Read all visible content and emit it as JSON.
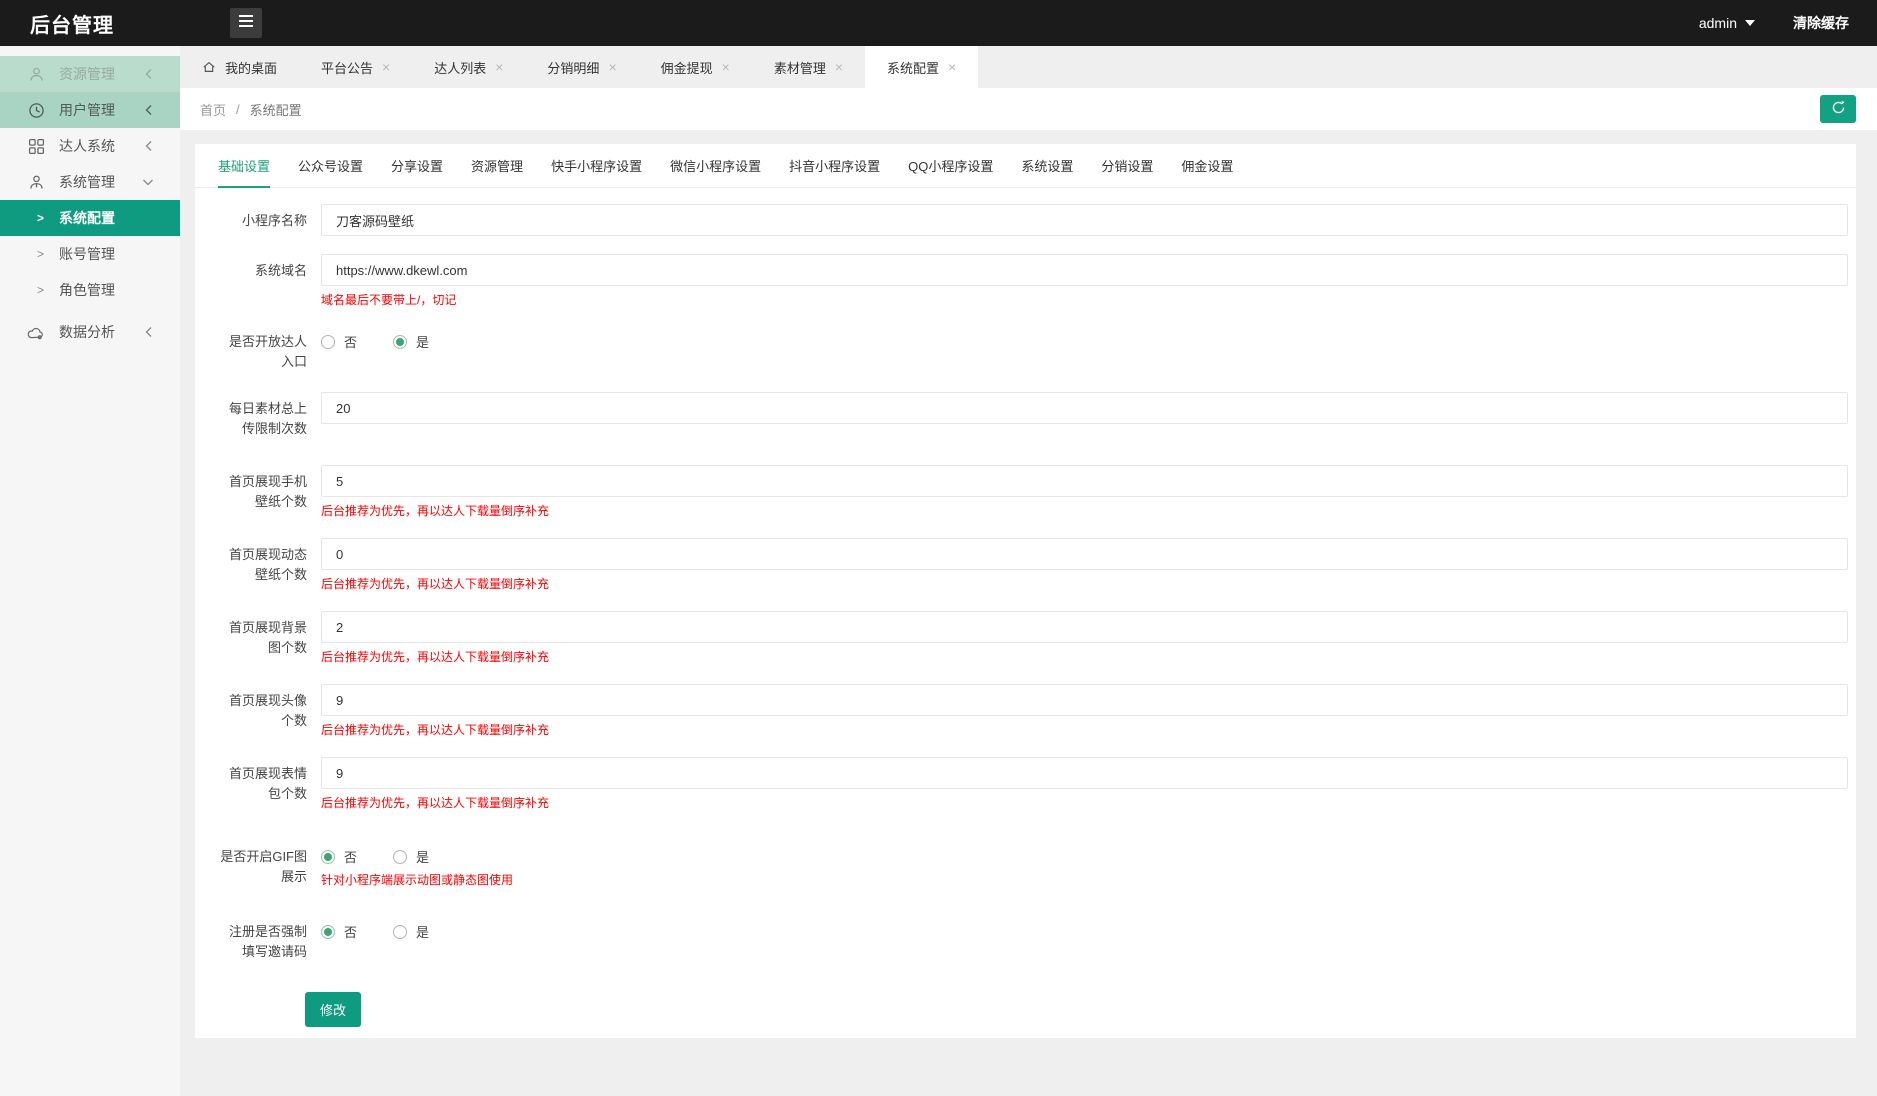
{
  "header": {
    "title": "后台管理",
    "user": "admin",
    "clear_cache_label": "清除缓存"
  },
  "window_tabs": {
    "items": [
      {
        "label": "我的桌面",
        "closable": false,
        "active": false
      },
      {
        "label": "平台公告",
        "closable": true,
        "active": false
      },
      {
        "label": "达人列表",
        "closable": true,
        "active": false
      },
      {
        "label": "分销明细",
        "closable": true,
        "active": false
      },
      {
        "label": "佣金提现",
        "closable": true,
        "active": false
      },
      {
        "label": "素材管理",
        "closable": true,
        "active": false
      },
      {
        "label": "系统配置",
        "closable": true,
        "active": true
      }
    ]
  },
  "breadcrumb": {
    "home": "首页",
    "separator": "/",
    "current": "系统配置"
  },
  "sidebar": {
    "items": [
      {
        "label": "资源管理",
        "icon": "user-icon",
        "chevron": "left",
        "state": "mint"
      },
      {
        "label": "用户管理",
        "icon": "clock-icon",
        "chevron": "left",
        "state": "mint"
      },
      {
        "label": "达人系统",
        "icon": "grid-icon",
        "chevron": "left",
        "state": "normal"
      },
      {
        "label": "系统管理",
        "icon": "person-tie-icon",
        "chevron": "down",
        "state": "expanded"
      },
      {
        "label": "系统配置",
        "type": "sub",
        "active": true
      },
      {
        "label": "账号管理",
        "type": "sub",
        "active": false
      },
      {
        "label": "角色管理",
        "type": "sub",
        "active": false
      },
      {
        "label": "数据分析",
        "icon": "cloud-icon",
        "chevron": "left",
        "state": "normal"
      }
    ]
  },
  "settings_tabs": {
    "items": [
      "基础设置",
      "公众号设置",
      "分享设置",
      "资源管理",
      "快手小程序设置",
      "微信小程序设置",
      "抖音小程序设置",
      "QQ小程序设置",
      "系统设置",
      "分销设置",
      "佣金设置"
    ],
    "active_index": 0
  },
  "form": {
    "fields": [
      {
        "label": "小程序名称",
        "type": "input",
        "value": "刀客源码壁纸"
      },
      {
        "label": "系统域名",
        "type": "input",
        "value": "https://www.dkewl.com",
        "hint": "域名最后不要带上/，切记"
      },
      {
        "label": "是否开放达人入口",
        "type": "radio",
        "options": [
          "否",
          "是"
        ],
        "selected": 1
      },
      {
        "label": "每日素材总上传限制次数",
        "type": "input",
        "value": "20"
      },
      {
        "label": "首页展现手机壁纸个数",
        "type": "input",
        "value": "5",
        "hint": "后台推荐为优先，再以达人下载量倒序补充"
      },
      {
        "label": "首页展现动态壁纸个数",
        "type": "input",
        "value": "0",
        "hint": "后台推荐为优先，再以达人下载量倒序补充"
      },
      {
        "label": "首页展现背景图个数",
        "type": "input",
        "value": "2",
        "hint": "后台推荐为优先，再以达人下载量倒序补充"
      },
      {
        "label": "首页展现头像个数",
        "type": "input",
        "value": "9",
        "hint": "后台推荐为优先，再以达人下载量倒序补充"
      },
      {
        "label": "首页展现表情包个数",
        "type": "input",
        "value": "9",
        "hint": "后台推荐为优先，再以达人下载量倒序补充"
      },
      {
        "label": "是否开启GIF图展示",
        "type": "radio",
        "options": [
          "否",
          "是"
        ],
        "selected": 0,
        "hint": "针对小程序端展示动图或静态图使用"
      },
      {
        "label": "注册是否强制填写邀请码",
        "type": "radio",
        "options": [
          "否",
          "是"
        ],
        "selected": 0
      }
    ],
    "submit_label": "修改"
  },
  "icons": {
    "close": "×",
    "arrow_right": "&gt;",
    "arrow_right_glyph": ">"
  },
  "colors": {
    "accent_teal": "#0e9b80",
    "refresh_teal": "#12a182",
    "tab_green": "#1fa273",
    "mint_light": "#b9dccd",
    "mint_dark": "#a9d4c4",
    "hint_red": "#ff0000",
    "header_bg": "#1b1b1b"
  }
}
